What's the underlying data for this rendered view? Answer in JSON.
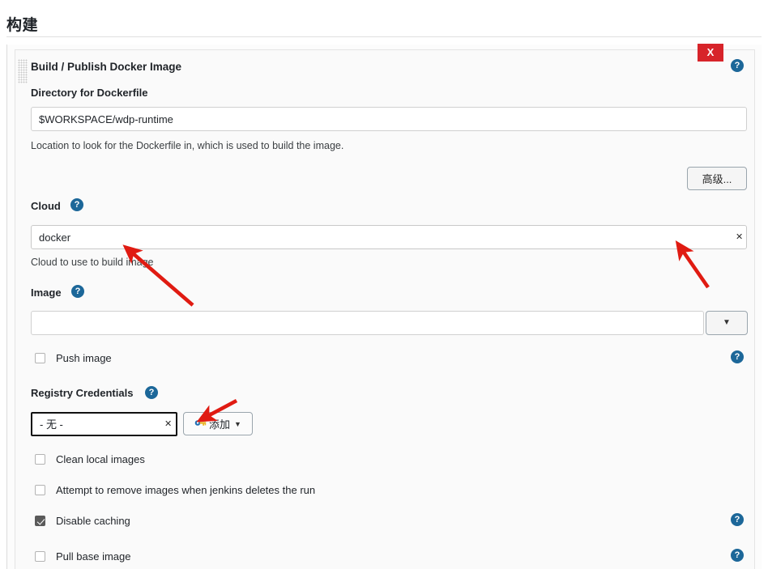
{
  "page": {
    "heading": "构建"
  },
  "block": {
    "title": "Build / Publish Docker Image",
    "delete_label": "X",
    "help_label": "?",
    "grip_name": "drag-handle"
  },
  "dockerfile": {
    "label": "Directory for Dockerfile",
    "value": "$WORKSPACE/wdp-runtime",
    "placeholder": "",
    "description": "Location to look for the Dockerfile in, which is used to build the image."
  },
  "advanced": {
    "label": "高级..."
  },
  "cloud": {
    "label": "Cloud",
    "help_label": "?",
    "selected": "docker",
    "options": [
      "docker"
    ],
    "description": "Cloud to use to build image"
  },
  "image": {
    "label": "Image",
    "help_label": "?",
    "value": "",
    "placeholder": "",
    "dropdown_label": "▼"
  },
  "push_image": {
    "label": "Push image",
    "checked": false,
    "help_label": "?"
  },
  "registry_credentials": {
    "label": "Registry Credentials",
    "help_label": "?",
    "selected": "- 无 -",
    "options": [
      "- 无 -"
    ],
    "add_label": "添加",
    "add_caret": "▼",
    "add_icon": "key-icon"
  },
  "options": [
    {
      "label": "Clean local images",
      "checked": false,
      "help": false
    },
    {
      "label": "Attempt to remove images when jenkins deletes the run",
      "checked": false,
      "help": false
    },
    {
      "label": "Disable caching",
      "checked": true,
      "help": true
    },
    {
      "label": "Pull base image",
      "checked": false,
      "help": true
    }
  ],
  "colors": {
    "delete_red": "#d7242a",
    "help_blue": "#1c6799",
    "annotation_red": "#e01b12",
    "checkbox_checked": "#5a5a5a",
    "page_bg": "#ffffff",
    "card_bg": "#fafafa"
  },
  "annotations": {
    "arrow_cloud_select": "points to cloud dropdown",
    "arrow_cloud_caret": "points to cloud dropdown caret",
    "arrow_add_credentials": "points to add credentials button"
  }
}
